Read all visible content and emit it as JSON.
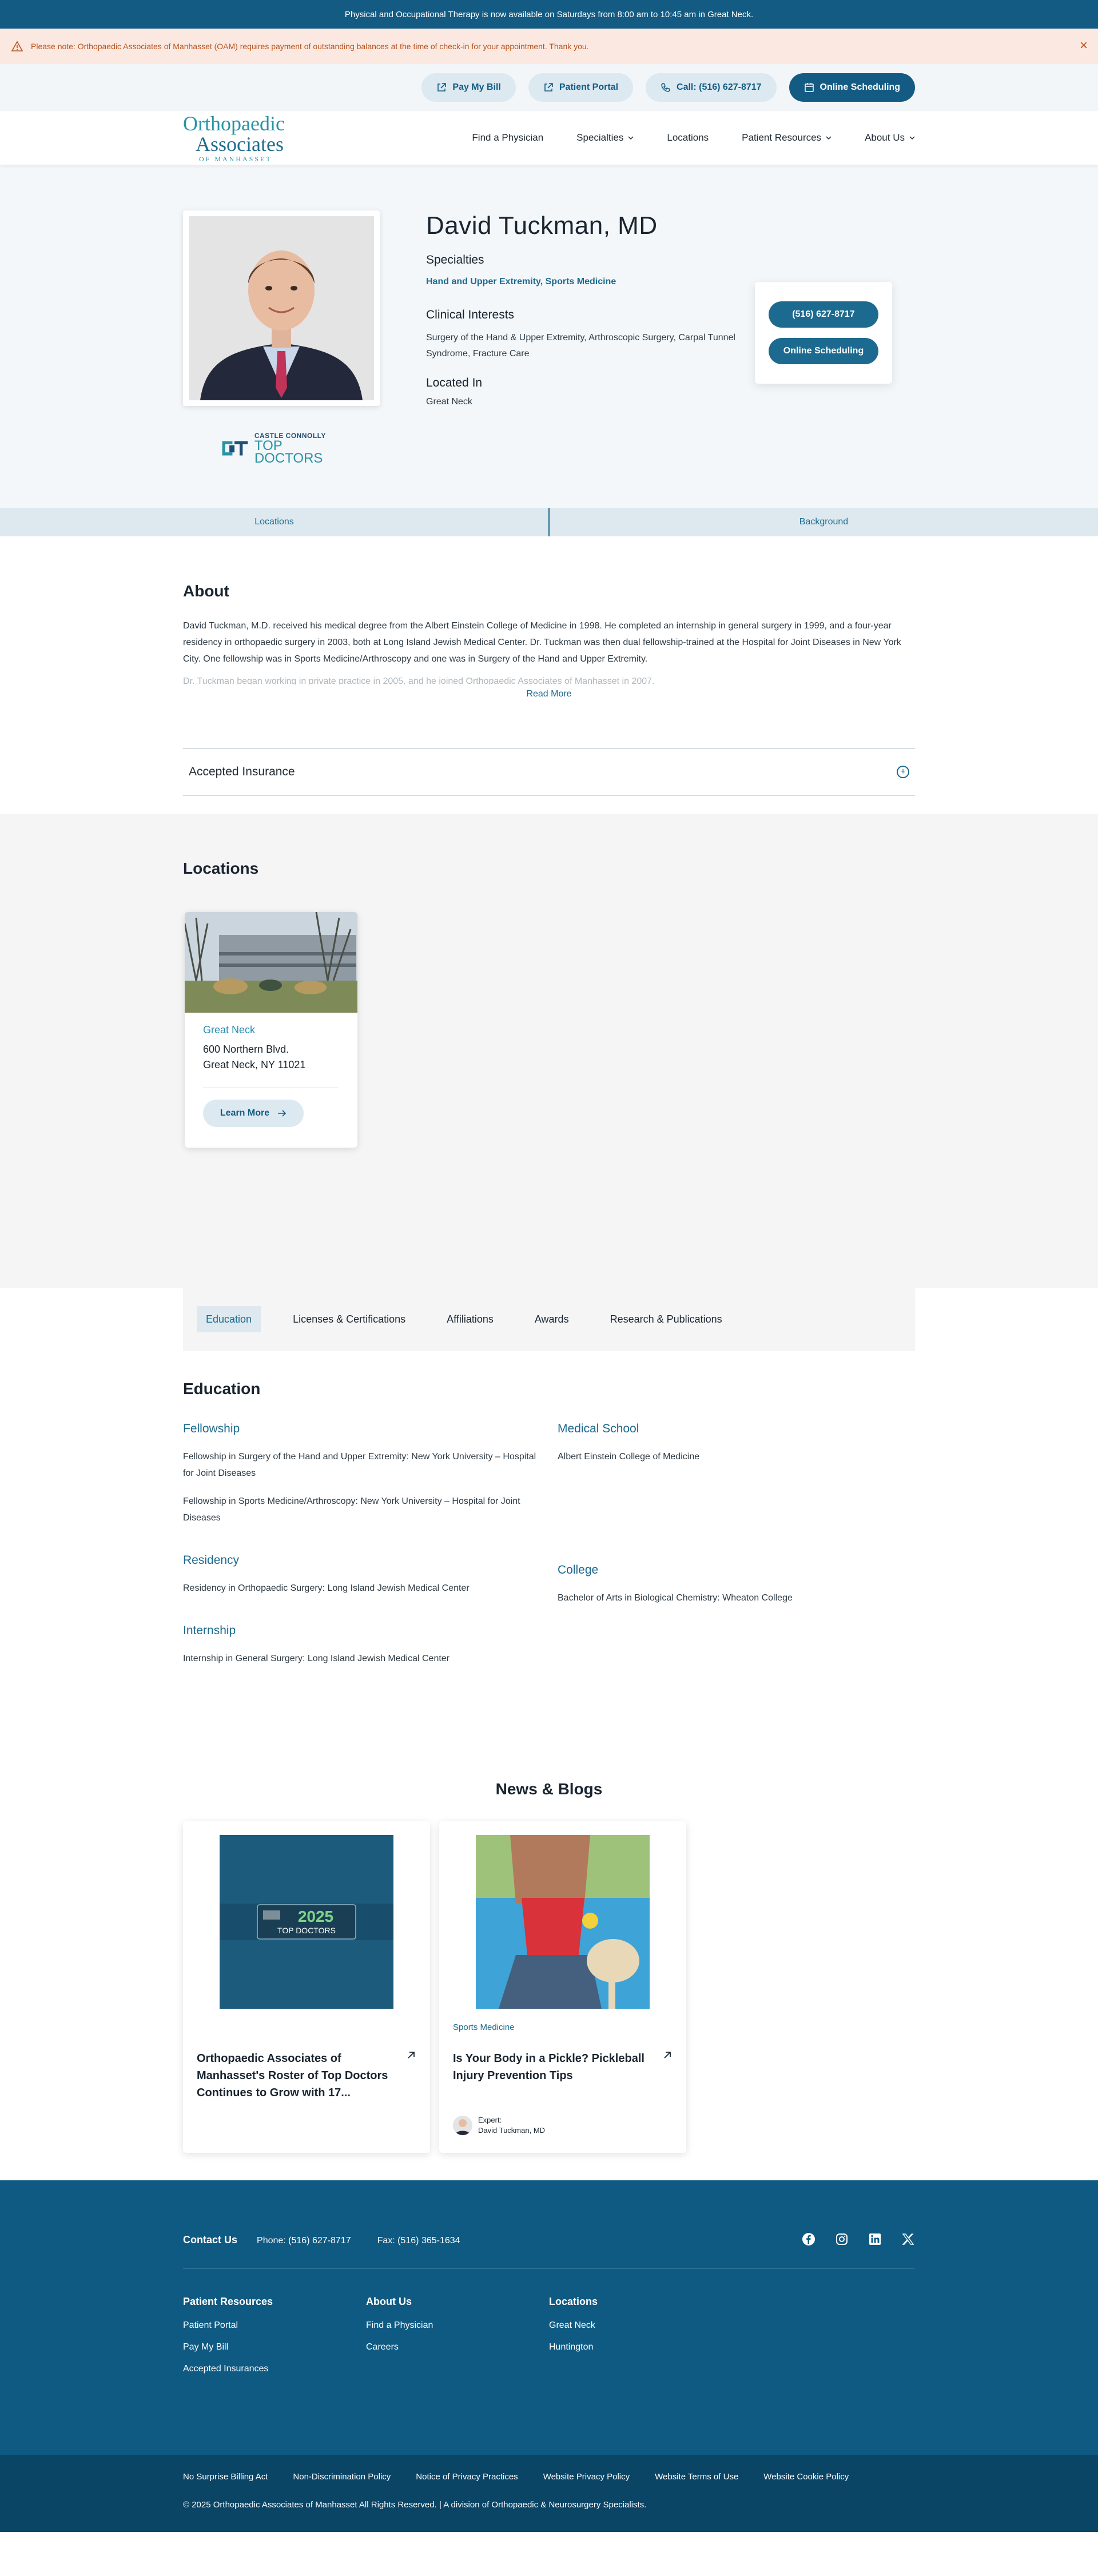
{
  "topbar": {
    "announcement": "Physical and Occupational Therapy is now available on Saturdays from 8:00 am to 10:45 am in Great Neck."
  },
  "alert": {
    "message": "Please note: Orthopaedic Associates of Manhasset (OAM) requires payment of outstanding balances at the time of check-in for your appointment. Thank you."
  },
  "utility": {
    "pay_bill": "Pay My Bill",
    "patient_portal": "Patient Portal",
    "call": "Call: (516) 627-8717",
    "online_scheduling": "Online Scheduling"
  },
  "logo": {
    "line1": "Orthopaedic",
    "line2": "Associates",
    "line3": "OF MANHASSET"
  },
  "nav": {
    "find_physician": "Find a Physician",
    "specialties": "Specialties",
    "locations": "Locations",
    "patient_resources": "Patient Resources",
    "about_us": "About Us"
  },
  "doctor": {
    "name": "David Tuckman, MD",
    "specialties_label": "Specialties",
    "specialties": "Hand and Upper Extremity, Sports Medicine",
    "clinical_label": "Clinical Interests",
    "clinical": "Surgery of the Hand & Upper Extremity, Arthroscopic Surgery, Carpal Tunnel Syndrome, Fracture Care",
    "located_label": "Located In",
    "located": "Great Neck",
    "phone_button": "(516) 627-8717",
    "schedule_button": "Online Scheduling",
    "badge": {
      "line1": "CASTLE CONNOLLY",
      "line2": "TOP DOCTORS"
    }
  },
  "anchors": {
    "locations": "Locations",
    "background": "Background"
  },
  "about": {
    "heading": "About",
    "paragraph": "David Tuckman, M.D. received his medical degree from the Albert Einstein College of Medicine in 1998. He completed an internship in general surgery in 1999, and a four-year residency in orthopaedic surgery in 2003, both at Long Island Jewish Medical Center. Dr. Tuckman was then dual fellowship-trained at the Hospital for Joint Diseases in New York City. One fellowship was in Sports Medicine/Arthroscopy and one was in Surgery of the Hand and Upper Extremity.",
    "faded": "Dr. Tuckman began working in private practice in 2005, and he joined Orthopaedic Associates of Manhasset in 2007.",
    "read_more": "Read More",
    "insurance": "Accepted Insurance"
  },
  "locations": {
    "heading": "Locations",
    "card": {
      "city": "Great Neck",
      "address1": "600 Northern Blvd.",
      "address2": "Great Neck, NY 11021",
      "button": "Learn More"
    }
  },
  "background_tabs": [
    "Education",
    "Licenses & Certifications",
    "Affiliations",
    "Awards",
    "Research & Publications"
  ],
  "education": {
    "heading": "Education",
    "fellowship": {
      "title": "Fellowship",
      "items": [
        "Fellowship in Surgery of the Hand and Upper Extremity: New York University – Hospital for Joint Diseases",
        "Fellowship in Sports Medicine/Arthroscopy: New York University – Hospital for Joint Diseases"
      ]
    },
    "residency": {
      "title": "Residency",
      "item": "Residency in Orthopaedic Surgery: Long Island Jewish Medical Center"
    },
    "internship": {
      "title": "Internship",
      "item": "Internship in General Surgery: Long Island Jewish Medical Center"
    },
    "medical_school": {
      "title": "Medical School",
      "item": "Albert Einstein College of Medicine"
    },
    "college": {
      "title": "College",
      "item": "Bachelor of Arts in Biological Chemistry: Wheaton College"
    }
  },
  "news": {
    "heading": "News & Blogs",
    "card1": {
      "title": "Orthopaedic Associates of Manhasset's Roster of Top Doctors Continues to Grow with 17...",
      "badge_year": "2025",
      "badge_text": "TOP DOCTORS"
    },
    "card2": {
      "category": "Sports Medicine",
      "title": "Is Your Body in a Pickle? Pickleball Injury Prevention Tips",
      "expert_label": "Expert:",
      "expert_name": "David Tuckman, MD"
    }
  },
  "footer": {
    "contact_us": "Contact Us",
    "phone": "Phone: (516) 627-8717",
    "fax": "Fax: (516) 365-1634",
    "patient_resources": {
      "title": "Patient Resources",
      "links": [
        "Patient Portal",
        "Pay My Bill",
        "Accepted Insurances"
      ]
    },
    "about_us": {
      "title": "About Us",
      "links": [
        "Find a Physician",
        "Careers"
      ]
    },
    "locations": {
      "title": "Locations",
      "links": [
        "Great Neck",
        "Huntington"
      ]
    },
    "legal": [
      "No Surprise Billing Act",
      "Non-Discrimination Policy",
      "Notice of Privacy Practices",
      "Website Privacy Policy",
      "Website Terms of Use",
      "Website Cookie Policy"
    ],
    "copyright": "© 2025 Orthopaedic Associates of Manhasset All Rights Reserved. | A division of Orthopaedic & Neurosurgery Specialists."
  },
  "colors": {
    "brand": "#135b83",
    "accent": "#2a93a6",
    "alert_bg": "#fbe9e1",
    "alert_text": "#b8521c"
  }
}
